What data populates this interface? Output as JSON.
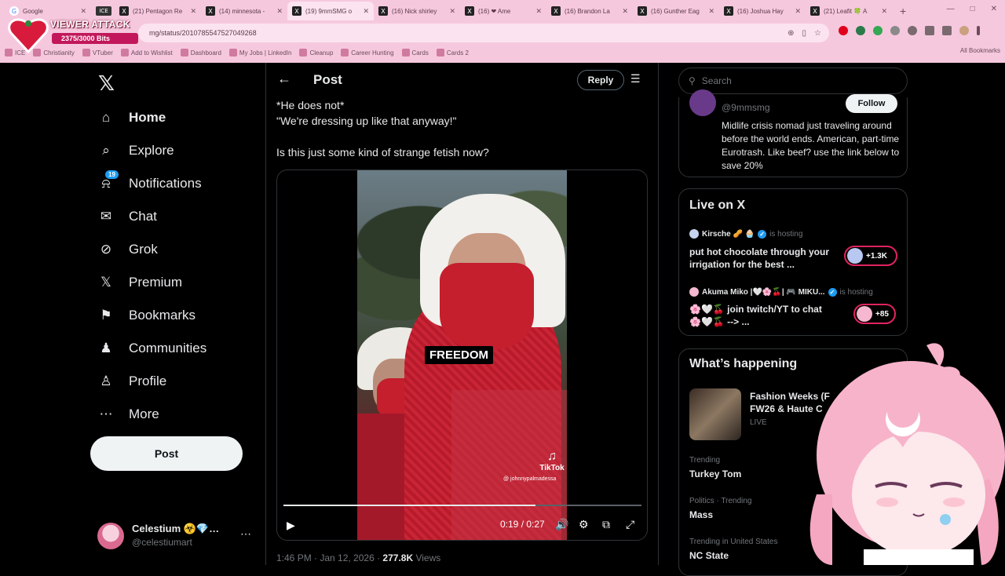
{
  "browser": {
    "tabs": [
      {
        "icon": "google-icon",
        "title": "Google"
      },
      {
        "icon": "ice-icon",
        "title": "ICE"
      },
      {
        "icon": "x-icon",
        "title": "(21) Pentagon Re"
      },
      {
        "icon": "x-icon",
        "title": "(14) minnesota -"
      },
      {
        "icon": "x-icon",
        "title": "(19) 9mmSMG o",
        "active": true
      },
      {
        "icon": "x-icon",
        "title": "(16) Nick shirley"
      },
      {
        "icon": "x-icon",
        "title": "(16) ❤ Ame"
      },
      {
        "icon": "x-icon",
        "title": "(16) Brandon La"
      },
      {
        "icon": "x-icon",
        "title": "(16) Gunther Eag"
      },
      {
        "icon": "x-icon",
        "title": "(16) Joshua Hay"
      },
      {
        "icon": "x-icon",
        "title": "(21) Leafit 🍀 A"
      }
    ],
    "url": "mg/status/2010785547527049268",
    "bookmarks": [
      "ICE",
      "Christianity",
      "VTuber",
      "Add to Wishlist",
      "Dashboard",
      "My Jobs | LinkedIn",
      "Cleanup",
      "Career Hunting",
      "Cards",
      "Cards 2"
    ],
    "all_bookmarks": "All Bookmarks"
  },
  "viewer_attack": {
    "title": "VIEWER ATTACK",
    "bits": "2375/3000 Bits",
    "progress_fraction": 0.7917
  },
  "nav": {
    "items": [
      {
        "icon": "home-icon",
        "label": "Home",
        "bold": true
      },
      {
        "icon": "search-icon",
        "label": "Explore"
      },
      {
        "icon": "bell-icon",
        "label": "Notifications",
        "badge": "19"
      },
      {
        "icon": "mail-icon",
        "label": "Chat"
      },
      {
        "icon": "grok-icon",
        "label": "Grok"
      },
      {
        "icon": "x-icon",
        "label": "Premium"
      },
      {
        "icon": "bookmark-icon",
        "label": "Bookmarks"
      },
      {
        "icon": "people-icon",
        "label": "Communities"
      },
      {
        "icon": "person-icon",
        "label": "Profile"
      },
      {
        "icon": "more-circle-icon",
        "label": "More"
      }
    ],
    "post_button": "Post",
    "account": {
      "name": "Celestium ☣️💎…",
      "handle": "@celestiumart"
    }
  },
  "main": {
    "title": "Post",
    "reply_button": "Reply",
    "lines": [
      "*He does not*",
      "\"We're dressing up like that anyway!\"",
      "",
      "Is this just some kind of strange fetish now?"
    ],
    "video": {
      "caption": "FREEDOM",
      "watermark": "TikTok",
      "watermark_handle": "@ johnnypalmadessa",
      "time": "0:19 / 0:27",
      "progress": 0.7037
    },
    "meta": {
      "time": "1:46 PM · Jan 12, 2026 ·",
      "views_count": "277.8K",
      "views_label": "Views"
    }
  },
  "right": {
    "search_placeholder": "Search",
    "bio": {
      "handle": "@9mmsmg",
      "follow": "Follow",
      "text": "Midlife crisis nomad just traveling around before the world ends. American, part-time Eurotrash. Like beef? use the link below to save 20%"
    },
    "live": {
      "title": "Live on X",
      "entries": [
        {
          "host": "Kirsche 🥜 🧁",
          "status": "is hosting",
          "text": "put hot chocolate through your irrigation for the best ...",
          "count": "+1.3K"
        },
        {
          "host": "Akuma Miko |🤍🌸🍒| 🎮 MIKU...",
          "status": "is hosting",
          "text": "🌸🤍🍒 join twitch/YT to chat 🌸🤍🍒 --> ...",
          "count": "+85"
        }
      ]
    },
    "happening": {
      "title": "What’s happening",
      "featured": {
        "title": "Fashion Weeks (F FW26 & Haute C",
        "status": "LIVE"
      },
      "trends": [
        {
          "context": "Trending",
          "name": "Turkey Tom"
        },
        {
          "context": "Politics · Trending",
          "name": "Mass"
        },
        {
          "context": "Trending in United States",
          "name": "NC State"
        }
      ]
    }
  }
}
